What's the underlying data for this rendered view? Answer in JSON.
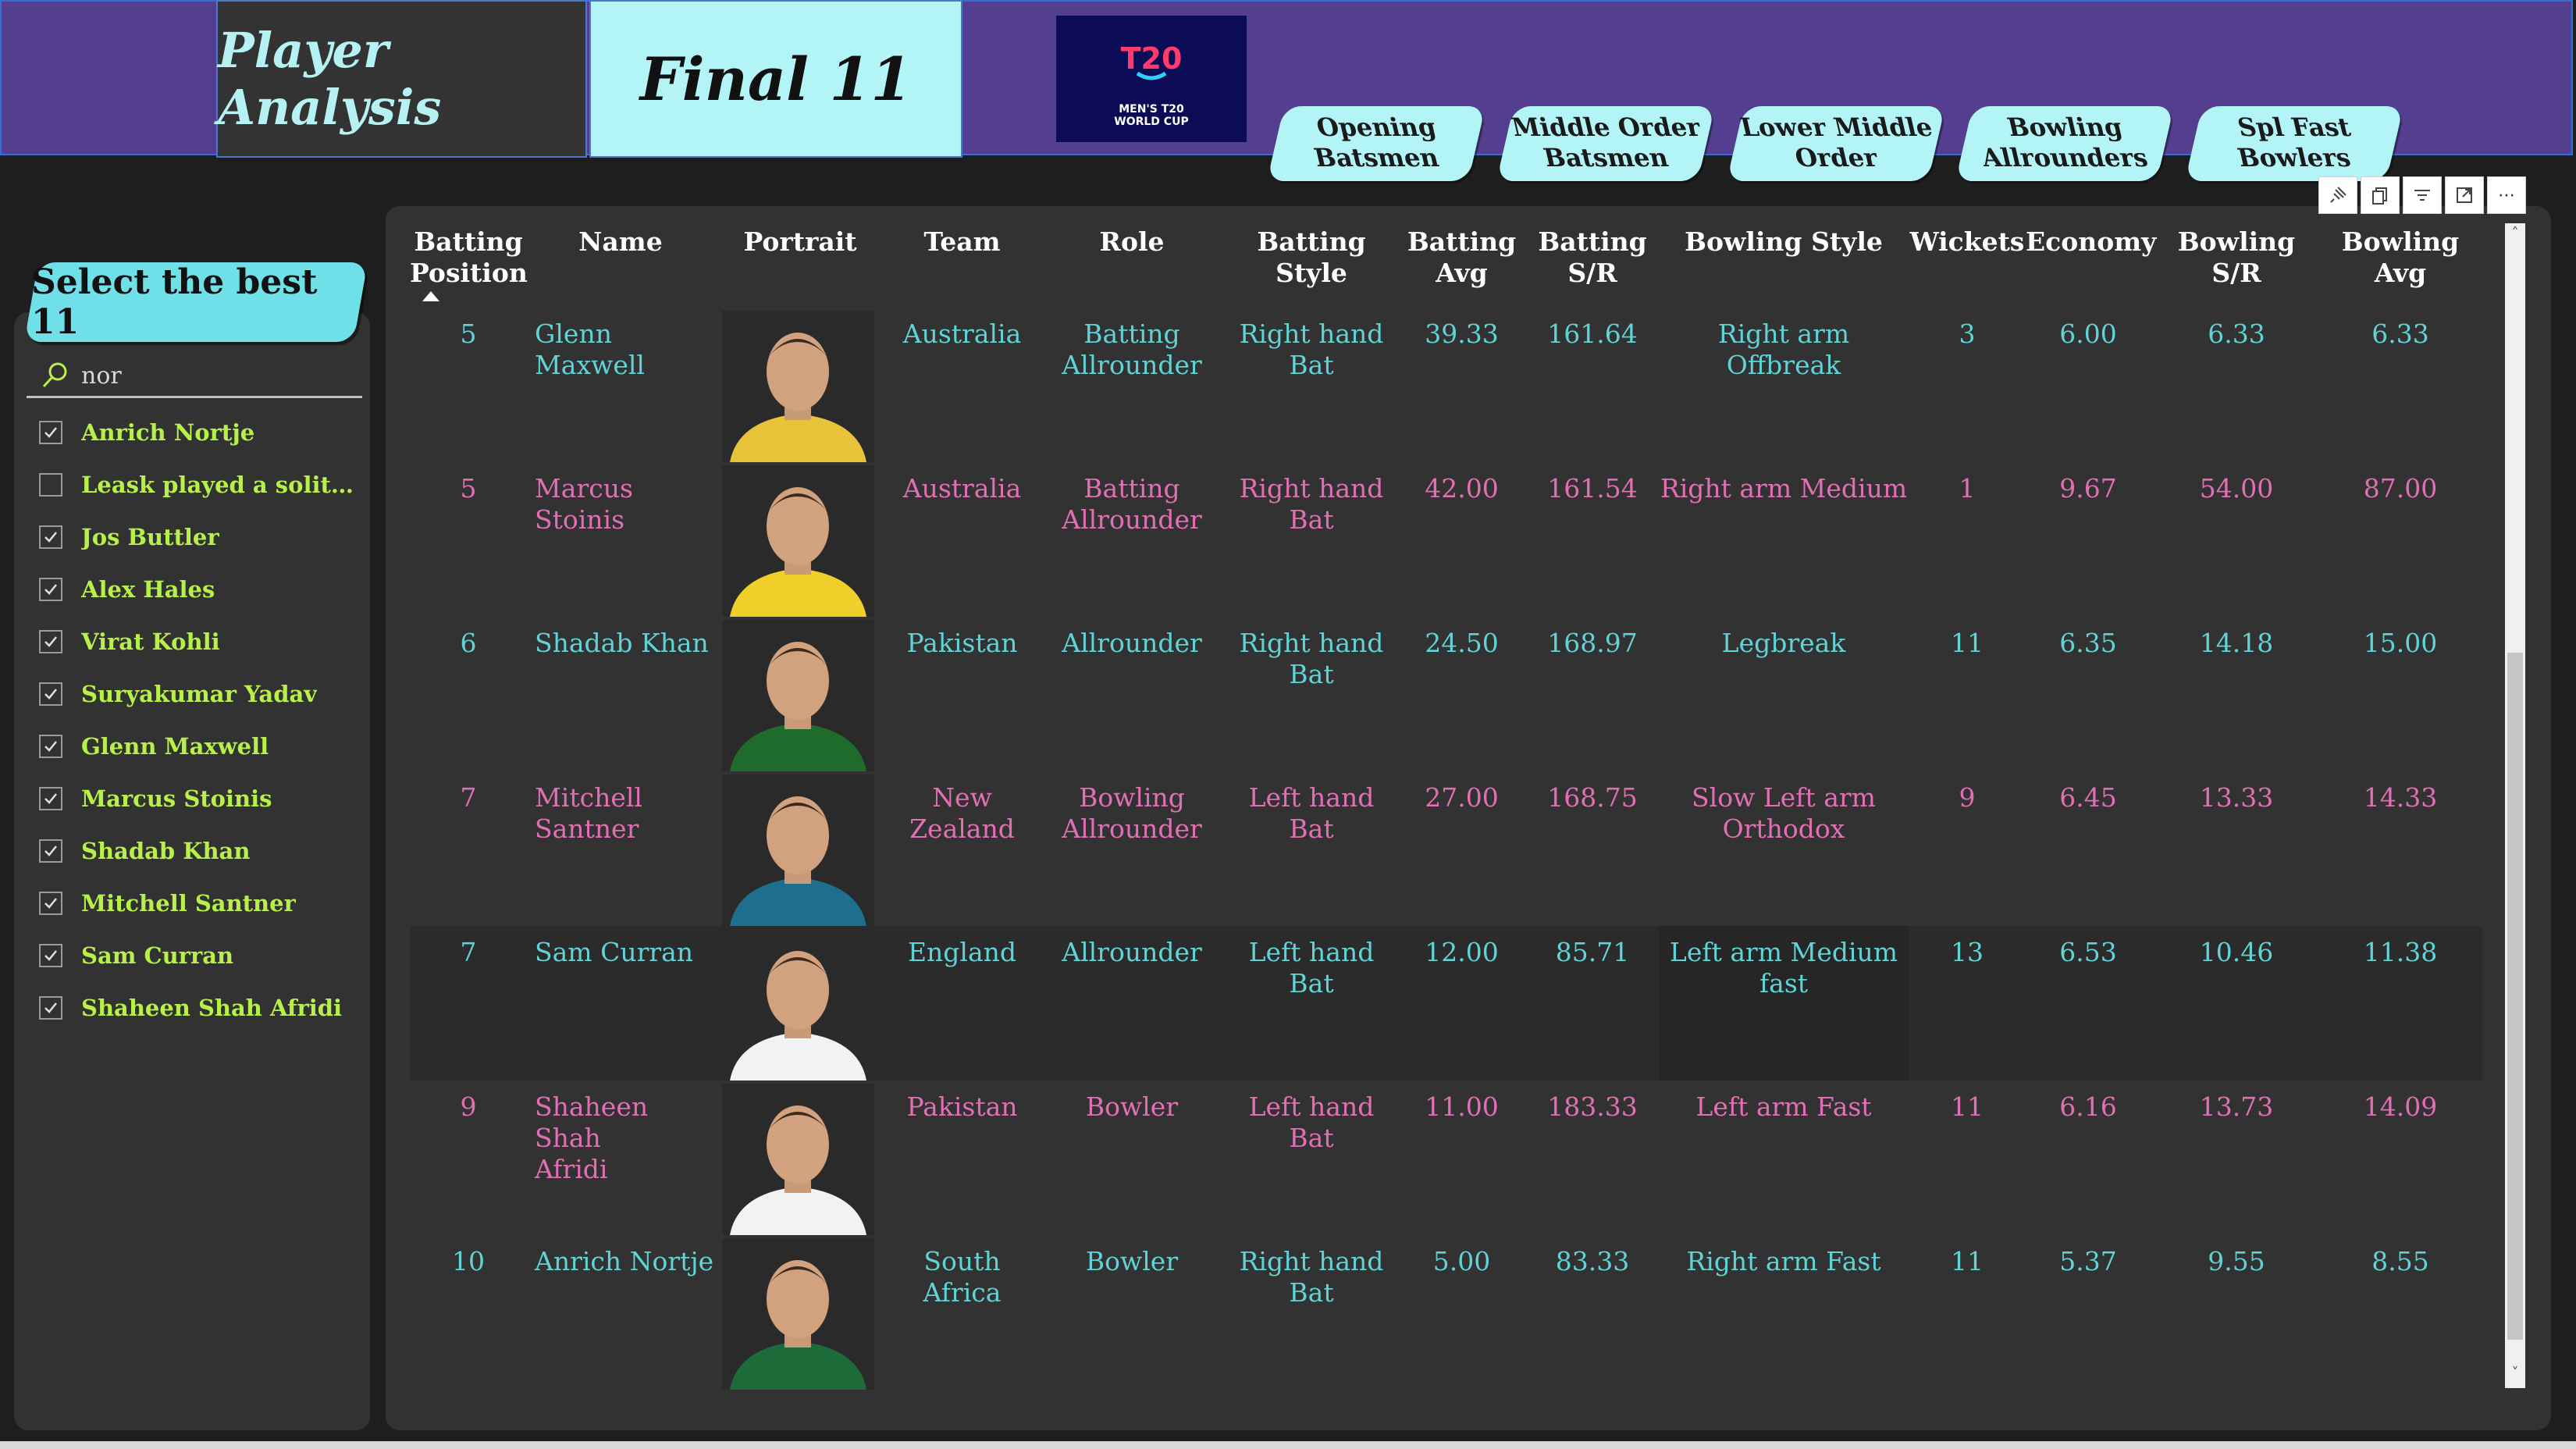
{
  "header": {
    "tab_player_analysis": "Player Analysis",
    "tab_final_11": "Final 11",
    "logo": {
      "icon": "t20-world-cup-logo",
      "text": "MEN'S T20 WORLD CUP"
    },
    "nav_buttons": [
      {
        "line1": "Opening",
        "line2": "Batsmen"
      },
      {
        "line1": "Middle Order",
        "line2": "Batsmen"
      },
      {
        "line1": "Lower Middle",
        "line2": "Order"
      },
      {
        "line1": "Bowling",
        "line2": "Allrounders"
      },
      {
        "line1": "Spl Fast",
        "line2": "Bowlers"
      }
    ]
  },
  "slicer": {
    "title": "Select the best 11",
    "search_value": "nor",
    "items": [
      {
        "label": "Anrich Nortje",
        "checked": true
      },
      {
        "label": "Leask played a solitary …",
        "checked": false
      },
      {
        "label": "Jos Buttler",
        "checked": true
      },
      {
        "label": "Alex Hales",
        "checked": true
      },
      {
        "label": "Virat Kohli",
        "checked": true
      },
      {
        "label": "Suryakumar Yadav",
        "checked": true
      },
      {
        "label": "Glenn Maxwell",
        "checked": true
      },
      {
        "label": "Marcus Stoinis",
        "checked": true
      },
      {
        "label": "Shadab Khan",
        "checked": true
      },
      {
        "label": "Mitchell Santner",
        "checked": true
      },
      {
        "label": "Sam Curran",
        "checked": true
      },
      {
        "label": "Shaheen Shah Afridi",
        "checked": true
      }
    ]
  },
  "toolbar": {
    "icons": [
      "pin-icon",
      "copy-icon",
      "filter-icon",
      "focus-mode-icon",
      "more-options-icon"
    ]
  },
  "table": {
    "headers": {
      "batting_position": [
        "Batting",
        "Position"
      ],
      "name": "Name",
      "portrait": "Portrait",
      "team": "Team",
      "role": "Role",
      "batting_style": "Batting Style",
      "batting_avg": [
        "Batting",
        "Avg"
      ],
      "batting_sr": [
        "Batting",
        "S/R"
      ],
      "bowling_style": "Bowling Style",
      "wickets": "Wickets",
      "economy": "Economy",
      "bowling_sr": "Bowling S/R",
      "bowling_avg": "Bowling Avg"
    },
    "colors": {
      "cyan": "#5fd3d6",
      "pink": "#e26fb5"
    },
    "rows": [
      {
        "pos": "5",
        "name": [
          "Glenn Maxwell"
        ],
        "team": [
          "Australia"
        ],
        "role": [
          "Batting",
          "Allrounder"
        ],
        "bat_style": [
          "Right hand",
          "Bat"
        ],
        "bat_avg": "39.33",
        "bat_sr": "161.64",
        "bowl_style": [
          "Right arm Offbreak"
        ],
        "wkts": "3",
        "eco": "6.00",
        "bowl_sr": "6.33",
        "bowl_avg": "6.33",
        "color": "cyan",
        "jersey": "#e8c33a"
      },
      {
        "pos": "5",
        "name": [
          "Marcus Stoinis"
        ],
        "team": [
          "Australia"
        ],
        "role": [
          "Batting",
          "Allrounder"
        ],
        "bat_style": [
          "Right hand",
          "Bat"
        ],
        "bat_avg": "42.00",
        "bat_sr": "161.54",
        "bowl_style": [
          "Right arm Medium"
        ],
        "wkts": "1",
        "eco": "9.67",
        "bowl_sr": "54.00",
        "bowl_avg": "87.00",
        "color": "pink",
        "jersey": "#f1cf2a"
      },
      {
        "pos": "6",
        "name": [
          "Shadab Khan"
        ],
        "team": [
          "Pakistan"
        ],
        "role": [
          "Allrounder"
        ],
        "bat_style": [
          "Right hand",
          "Bat"
        ],
        "bat_avg": "24.50",
        "bat_sr": "168.97",
        "bowl_style": [
          "Legbreak"
        ],
        "wkts": "11",
        "eco": "6.35",
        "bowl_sr": "14.18",
        "bowl_avg": "15.00",
        "color": "cyan",
        "jersey": "#1f6b2c"
      },
      {
        "pos": "7",
        "name": [
          "Mitchell",
          "Santner"
        ],
        "team": [
          "New",
          "Zealand"
        ],
        "role": [
          "Bowling",
          "Allrounder"
        ],
        "bat_style": [
          "Left hand Bat"
        ],
        "bat_avg": "27.00",
        "bat_sr": "168.75",
        "bowl_style": [
          "Slow Left arm",
          "Orthodox"
        ],
        "wkts": "9",
        "eco": "6.45",
        "bowl_sr": "13.33",
        "bowl_avg": "14.33",
        "color": "pink",
        "jersey": "#1e6f8e"
      },
      {
        "pos": "7",
        "name": [
          "Sam Curran"
        ],
        "team": [
          "England"
        ],
        "role": [
          "Allrounder"
        ],
        "bat_style": [
          "Left hand Bat"
        ],
        "bat_avg": "12.00",
        "bat_sr": "85.71",
        "bowl_style": [
          "Left arm Medium",
          "fast"
        ],
        "wkts": "13",
        "eco": "6.53",
        "bowl_sr": "10.46",
        "bowl_avg": "11.38",
        "color": "cyan",
        "jersey": "#f2f2f2"
      },
      {
        "pos": "9",
        "name": [
          "Shaheen Shah",
          "Afridi"
        ],
        "team": [
          "Pakistan"
        ],
        "role": [
          "Bowler"
        ],
        "bat_style": [
          "Left hand Bat"
        ],
        "bat_avg": "11.00",
        "bat_sr": "183.33",
        "bowl_style": [
          "Left arm Fast"
        ],
        "wkts": "11",
        "eco": "6.16",
        "bowl_sr": "13.73",
        "bowl_avg": "14.09",
        "color": "pink",
        "jersey": "#f2f2f2"
      },
      {
        "pos": "10",
        "name": [
          "Anrich Nortje"
        ],
        "team": [
          "South",
          "Africa"
        ],
        "role": [
          "Bowler"
        ],
        "bat_style": [
          "Right hand",
          "Bat"
        ],
        "bat_avg": "5.00",
        "bat_sr": "83.33",
        "bowl_style": [
          "Right arm Fast"
        ],
        "wkts": "11",
        "eco": "5.37",
        "bowl_sr": "9.55",
        "bowl_avg": "8.55",
        "color": "cyan",
        "jersey": "#1e6b3a"
      }
    ]
  }
}
